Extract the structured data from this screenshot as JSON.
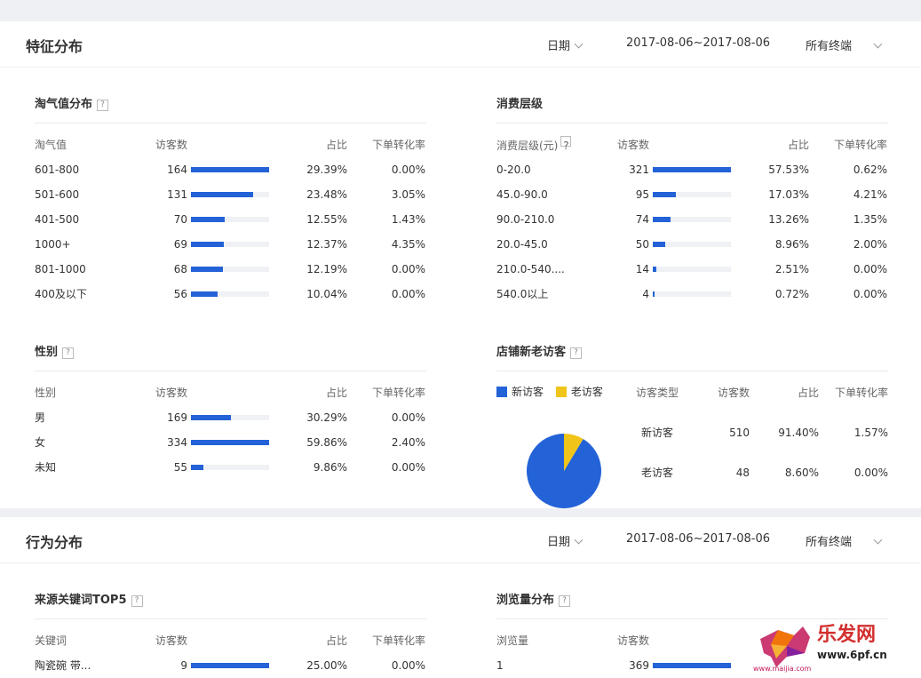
{
  "panel1": {
    "title": "特征分布",
    "date_label": "日期",
    "date_range": "2017-08-06~2017-08-06",
    "terminal": "所有终端"
  },
  "taoqi": {
    "title": "淘气值分布",
    "headers": [
      "淘气值",
      "访客数",
      "占比",
      "下单转化率"
    ],
    "rows": [
      {
        "label": "601-800",
        "visitors": "164",
        "share": "29.39%",
        "conv": "0.00%",
        "pct": 1.0
      },
      {
        "label": "501-600",
        "visitors": "131",
        "share": "23.48%",
        "conv": "3.05%",
        "pct": 0.8
      },
      {
        "label": "401-500",
        "visitors": "70",
        "share": "12.55%",
        "conv": "1.43%",
        "pct": 0.43
      },
      {
        "label": "1000+",
        "visitors": "69",
        "share": "12.37%",
        "conv": "4.35%",
        "pct": 0.42
      },
      {
        "label": "801-1000",
        "visitors": "68",
        "share": "12.19%",
        "conv": "0.00%",
        "pct": 0.41
      },
      {
        "label": "400及以下",
        "visitors": "56",
        "share": "10.04%",
        "conv": "0.00%",
        "pct": 0.34
      }
    ]
  },
  "consume": {
    "title": "消费层级",
    "headers": [
      "消费层级(元)",
      "访客数",
      "占比",
      "下单转化率"
    ],
    "rows": [
      {
        "label": "0-20.0",
        "visitors": "321",
        "share": "57.53%",
        "conv": "0.62%",
        "pct": 1.0
      },
      {
        "label": "45.0-90.0",
        "visitors": "95",
        "share": "17.03%",
        "conv": "4.21%",
        "pct": 0.3
      },
      {
        "label": "90.0-210.0",
        "visitors": "74",
        "share": "13.26%",
        "conv": "1.35%",
        "pct": 0.23
      },
      {
        "label": "20.0-45.0",
        "visitors": "50",
        "share": "8.96%",
        "conv": "2.00%",
        "pct": 0.16
      },
      {
        "label": "210.0-540....",
        "visitors": "14",
        "share": "2.51%",
        "conv": "0.00%",
        "pct": 0.044
      },
      {
        "label": "540.0以上",
        "visitors": "4",
        "share": "0.72%",
        "conv": "0.00%",
        "pct": 0.013
      }
    ]
  },
  "gender": {
    "title": "性别",
    "headers": [
      "性别",
      "访客数",
      "占比",
      "下单转化率"
    ],
    "rows": [
      {
        "label": "男",
        "visitors": "169",
        "share": "30.29%",
        "conv": "0.00%",
        "pct": 0.51
      },
      {
        "label": "女",
        "visitors": "334",
        "share": "59.86%",
        "conv": "2.40%",
        "pct": 1.0
      },
      {
        "label": "未知",
        "visitors": "55",
        "share": "9.86%",
        "conv": "0.00%",
        "pct": 0.16
      }
    ]
  },
  "newold": {
    "title": "店铺新老访客",
    "legend_new": "新访客",
    "legend_old": "老访客",
    "color_new": "#2462d7",
    "color_old": "#f0c419",
    "headers": [
      "访客类型",
      "访客数",
      "占比",
      "下单转化率"
    ],
    "rows": [
      {
        "label": "新访客",
        "visitors": "510",
        "share": "91.40%",
        "conv": "1.57%"
      },
      {
        "label": "老访客",
        "visitors": "48",
        "share": "8.60%",
        "conv": "0.00%"
      }
    ],
    "pie_new_fraction": 0.914
  },
  "panel2": {
    "title": "行为分布",
    "date_label": "日期",
    "date_range": "2017-08-06~2017-08-06",
    "terminal": "所有终端"
  },
  "keywords": {
    "title": "来源关键词TOP5",
    "headers": [
      "关键词",
      "访客数",
      "占比",
      "下单转化率"
    ],
    "rows": [
      {
        "label": "陶瓷碗 带...",
        "visitors": "9",
        "share": "25.00%",
        "conv": "0.00%",
        "pct": 1.0
      }
    ]
  },
  "pageviews": {
    "title": "浏览量分布",
    "headers": [
      "浏览量",
      "访客数"
    ],
    "rows": [
      {
        "label": "1",
        "visitors": "369",
        "pct": 1.0
      }
    ]
  },
  "watermark": {
    "brand": "乐发网",
    "url": "www.6pf.cn",
    "small": "www.maijia.com"
  }
}
